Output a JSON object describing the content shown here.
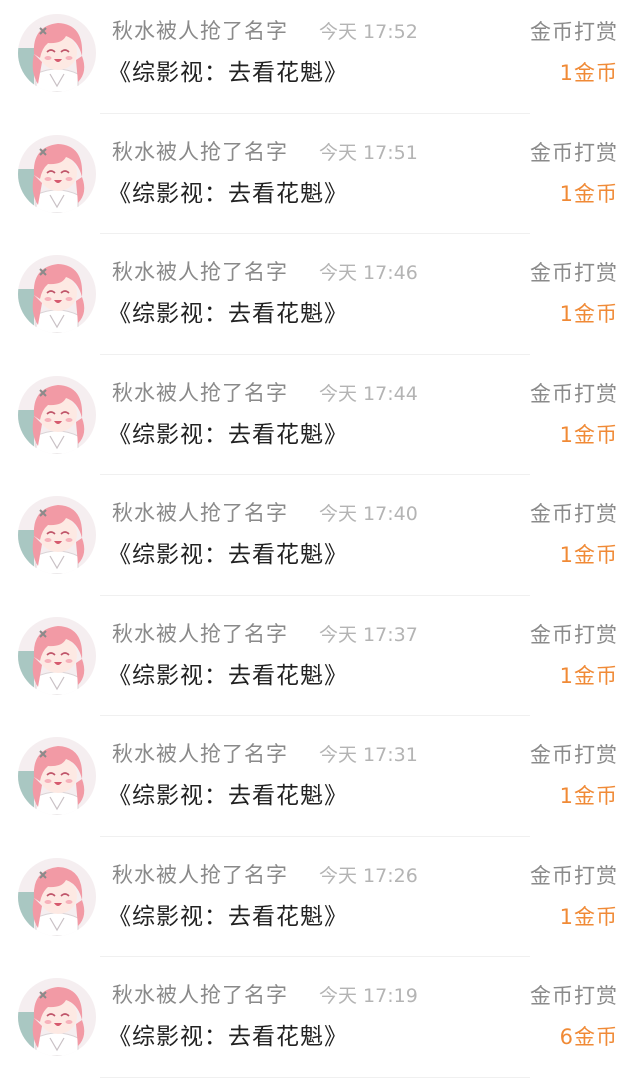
{
  "colors": {
    "name": "#8a8a8a",
    "time": "#b4b4b4",
    "title": "#222222",
    "amount": "#f08a36",
    "divider": "#f0f0f0"
  },
  "records": [
    {
      "user": "秋水被人抢了名字",
      "time": "今天 17:52",
      "book": "《综影视：去看花魁》",
      "reward_type": "金币打赏",
      "amount": "1金币",
      "avatar_icon": "pink-hair-anime-girl-avatar"
    },
    {
      "user": "秋水被人抢了名字",
      "time": "今天 17:51",
      "book": "《综影视：去看花魁》",
      "reward_type": "金币打赏",
      "amount": "1金币",
      "avatar_icon": "pink-hair-anime-girl-avatar"
    },
    {
      "user": "秋水被人抢了名字",
      "time": "今天 17:46",
      "book": "《综影视：去看花魁》",
      "reward_type": "金币打赏",
      "amount": "1金币",
      "avatar_icon": "pink-hair-anime-girl-avatar"
    },
    {
      "user": "秋水被人抢了名字",
      "time": "今天 17:44",
      "book": "《综影视：去看花魁》",
      "reward_type": "金币打赏",
      "amount": "1金币",
      "avatar_icon": "pink-hair-anime-girl-avatar"
    },
    {
      "user": "秋水被人抢了名字",
      "time": "今天 17:40",
      "book": "《综影视：去看花魁》",
      "reward_type": "金币打赏",
      "amount": "1金币",
      "avatar_icon": "pink-hair-anime-girl-avatar"
    },
    {
      "user": "秋水被人抢了名字",
      "time": "今天 17:37",
      "book": "《综影视：去看花魁》",
      "reward_type": "金币打赏",
      "amount": "1金币",
      "avatar_icon": "pink-hair-anime-girl-avatar"
    },
    {
      "user": "秋水被人抢了名字",
      "time": "今天 17:31",
      "book": "《综影视：去看花魁》",
      "reward_type": "金币打赏",
      "amount": "1金币",
      "avatar_icon": "pink-hair-anime-girl-avatar"
    },
    {
      "user": "秋水被人抢了名字",
      "time": "今天 17:26",
      "book": "《综影视：去看花魁》",
      "reward_type": "金币打赏",
      "amount": "1金币",
      "avatar_icon": "pink-hair-anime-girl-avatar"
    },
    {
      "user": "秋水被人抢了名字",
      "time": "今天 17:19",
      "book": "《综影视：去看花魁》",
      "reward_type": "金币打赏",
      "amount": "6金币",
      "avatar_icon": "pink-hair-anime-girl-avatar"
    }
  ]
}
